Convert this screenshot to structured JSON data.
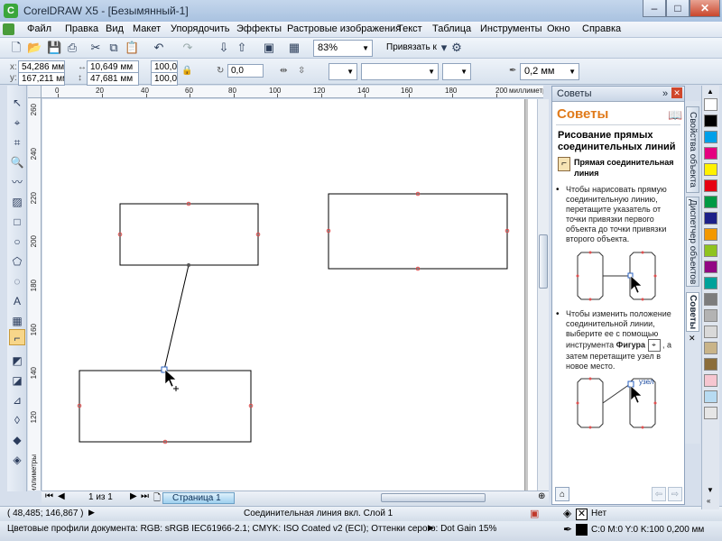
{
  "window": {
    "title": "CorelDRAW X5 - [Безымянный-1]",
    "controls": [
      "–",
      "□",
      "✕"
    ]
  },
  "menu": [
    "Файл",
    "Правка",
    "Вид",
    "Макет",
    "Упорядочить",
    "Эффекты",
    "Растровые изображения",
    "Текст",
    "Таблица",
    "Инструменты",
    "Окно",
    "Справка"
  ],
  "toolbar": {
    "zoom": "83%",
    "snap_label": "Привязать к"
  },
  "propbar": {
    "x": "54,286 мм",
    "y": "167,211 мм",
    "w": "10,649 мм",
    "h": "47,681 мм",
    "x_label": "x:",
    "y_label": "y:",
    "scale_x": "100,0",
    "scale_y": "100,0",
    "angle": "0,0",
    "outline_width": "0,2 мм"
  },
  "rulers": {
    "h_ticks": [
      "0",
      "20",
      "40",
      "60",
      "80",
      "100",
      "120",
      "140",
      "160",
      "180",
      "200"
    ],
    "h_unit": "миллиметры",
    "v_ticks": [
      "260",
      "240",
      "220",
      "200",
      "180",
      "160",
      "140",
      "120"
    ],
    "v_unit": "миллиметры"
  },
  "pages": {
    "counter": "1 из 1",
    "tab": "Страница 1"
  },
  "status": {
    "coords": "( 48,485; 146,867 )",
    "selection": "Соединительная линия вкл. Слой 1",
    "color_profile": "Цветовые профили документа: RGB: sRGB IEC61966-2.1; CMYK: ISO Coated v2 (ECI); Оттенки серого: Dot Gain 15%",
    "fill": "Нет",
    "outline": "C:0 M:0 Y:0 K:100  0,200 мм"
  },
  "docker": {
    "header": "Советы",
    "title": "Советы",
    "heading": "Рисование прямых соединительных линий",
    "tool_name": "Прямая соединительная линия",
    "tip1": "Чтобы нарисовать прямую соединительную линию, перетащите указатель от точки привязки первого объекта до точки привязки второго объекта.",
    "tip2_a": "Чтобы изменить положение соединительной линии, выберите ее с помощью инструмента",
    "tip2_tool": "Фигура",
    "tip2_b": ", а затем перетащите узел в новое место.",
    "node_label": "узел"
  },
  "docker_tabs": [
    "Свойства объекта",
    "Диспетчер объектов",
    "Советы"
  ],
  "palette": [
    "#ffffff",
    "#000000",
    "#00a0e9",
    "#e5007f",
    "#fff100",
    "#e60012",
    "#009944",
    "#1d2088",
    "#f39800",
    "#8fc31f",
    "#920783",
    "#00a29a",
    "#7d7d7d",
    "#b3b3b3",
    "#d9d9d9",
    "#c9b489",
    "#8b6d3a",
    "#f6c6d0",
    "#b7dbf2",
    "#e6e6e6"
  ]
}
